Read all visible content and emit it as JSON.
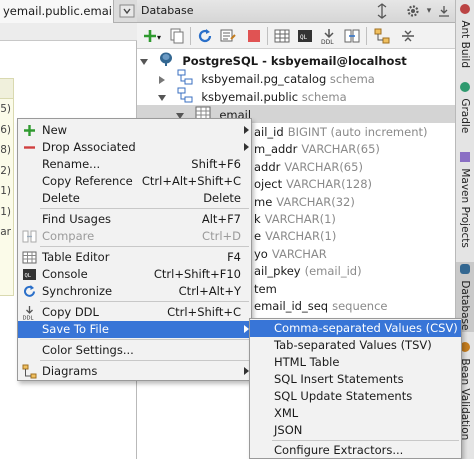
{
  "editor": {
    "tab_title": "yemail.public.email",
    "grid_row_numbers": [
      "5)",
      "6)",
      "8)",
      "2)",
      "1)",
      "1)",
      "ar"
    ]
  },
  "db_panel": {
    "title": "Database"
  },
  "tree": {
    "connection": "PostgreSQL - ksbyemail@localhost",
    "schema1": {
      "name": "ksbyemail.pg_catalog",
      "type": "schema"
    },
    "schema2": {
      "name": "ksbyemail.public",
      "type": "schema"
    },
    "table": "email",
    "columns": [
      {
        "name": "ail_id",
        "type": "BIGINT (auto increment)"
      },
      {
        "name": "m_addr",
        "type": "VARCHAR(65)"
      },
      {
        "name": "addr",
        "type": "VARCHAR(65)"
      },
      {
        "name": "oject",
        "type": "VARCHAR(128)"
      },
      {
        "name": "me",
        "type": "VARCHAR(32)"
      },
      {
        "name": "k",
        "type": "VARCHAR(1)"
      },
      {
        "name": "e",
        "type": "VARCHAR(1)"
      },
      {
        "name": "yo",
        "type": "VARCHAR"
      },
      {
        "name": "ail_pkey",
        "type": "(email_id)"
      },
      {
        "name": "tem",
        "type": ""
      },
      {
        "name": "email_id_seq",
        "type": "sequence"
      }
    ]
  },
  "right_strip": {
    "tabs": [
      "Ant Build",
      "Gradle",
      "Maven Projects",
      "Database",
      "Bean Validation"
    ]
  },
  "context_menu": {
    "items": [
      {
        "label": "New",
        "shortcut": "",
        "icon": "plus-icon",
        "submenu": true,
        "disabled": false
      },
      {
        "label": "Drop Associated",
        "shortcut": "",
        "icon": "minus-icon",
        "submenu": true,
        "disabled": false
      },
      {
        "label": "Rename...",
        "shortcut": "Shift+F6",
        "icon": "",
        "submenu": false,
        "disabled": false
      },
      {
        "label": "Copy Reference",
        "shortcut": "Ctrl+Alt+Shift+C",
        "icon": "",
        "submenu": false,
        "disabled": false
      },
      {
        "label": "Delete",
        "shortcut": "Delete",
        "icon": "",
        "submenu": false,
        "disabled": false
      },
      {
        "label": "Find Usages",
        "shortcut": "Alt+F7",
        "icon": "",
        "submenu": false,
        "disabled": false
      },
      {
        "label": "Compare",
        "shortcut": "Ctrl+D",
        "icon": "compare-icon",
        "submenu": false,
        "disabled": true
      },
      {
        "label": "Table Editor",
        "shortcut": "F4",
        "icon": "table-icon",
        "submenu": false,
        "disabled": false
      },
      {
        "label": "Console",
        "shortcut": "Ctrl+Shift+F10",
        "icon": "console-icon",
        "submenu": false,
        "disabled": false
      },
      {
        "label": "Synchronize",
        "shortcut": "Ctrl+Alt+Y",
        "icon": "sync-icon",
        "submenu": false,
        "disabled": false
      },
      {
        "label": "Copy DDL",
        "shortcut": "Ctrl+Shift+C",
        "icon": "ddl-icon",
        "submenu": false,
        "disabled": false
      },
      {
        "label": "Save To File",
        "shortcut": "",
        "icon": "",
        "submenu": true,
        "disabled": false,
        "selected": true
      },
      {
        "label": "Color Settings...",
        "shortcut": "",
        "icon": "",
        "submenu": false,
        "disabled": false
      },
      {
        "label": "Diagrams",
        "shortcut": "",
        "icon": "diagram-icon",
        "submenu": true,
        "disabled": false
      }
    ]
  },
  "submenu": {
    "items": [
      {
        "label": "Comma-separated Values (CSV)",
        "selected": true
      },
      {
        "label": "Tab-separated Values (TSV)"
      },
      {
        "label": "HTML Table"
      },
      {
        "label": "SQL Insert Statements"
      },
      {
        "label": "SQL Update Statements"
      },
      {
        "label": "XML"
      },
      {
        "label": "JSON"
      },
      {
        "label": "Configure Extractors..."
      }
    ]
  },
  "colors": {
    "selection": "#3875d7",
    "menu_bg": "#f2f2f2",
    "tree_selected": "#d4d4d4"
  }
}
